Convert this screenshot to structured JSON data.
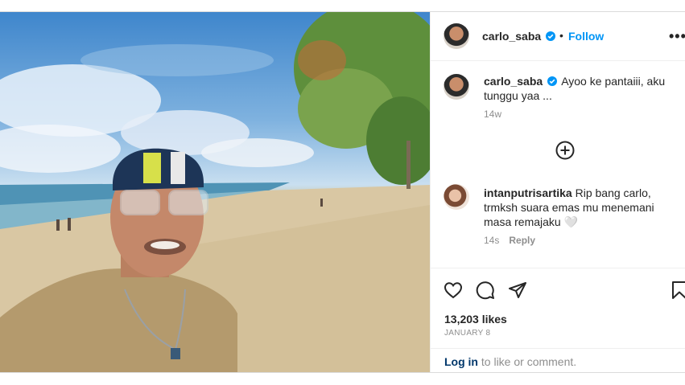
{
  "post": {
    "author": "carlo_saba",
    "follow_label": "Follow",
    "separator": "•",
    "more_label": "•••"
  },
  "caption": {
    "author": "carlo_saba",
    "text": "Ayoo ke pantaiii, aku tunggu yaa ...",
    "age": "14w"
  },
  "comment": {
    "author": "intanputrisartika",
    "text": "Rip bang carlo, trmksh suara emas mu menemani masa remajaku 🤍",
    "age": "14s",
    "reply_label": "Reply"
  },
  "stats": {
    "likes": "13,203 likes",
    "date": "JANUARY 8"
  },
  "login": {
    "link": "Log in",
    "rest": " to like or comment."
  },
  "icons": {
    "verified": "verified-badge-icon",
    "add": "add-comment-icon",
    "like": "heart-icon",
    "comment": "comment-bubble-icon",
    "share": "paper-plane-icon",
    "save": "bookmark-icon"
  },
  "colors": {
    "accent": "#0095f6",
    "verified": "#0095f6",
    "muted": "#8e8e8e"
  }
}
